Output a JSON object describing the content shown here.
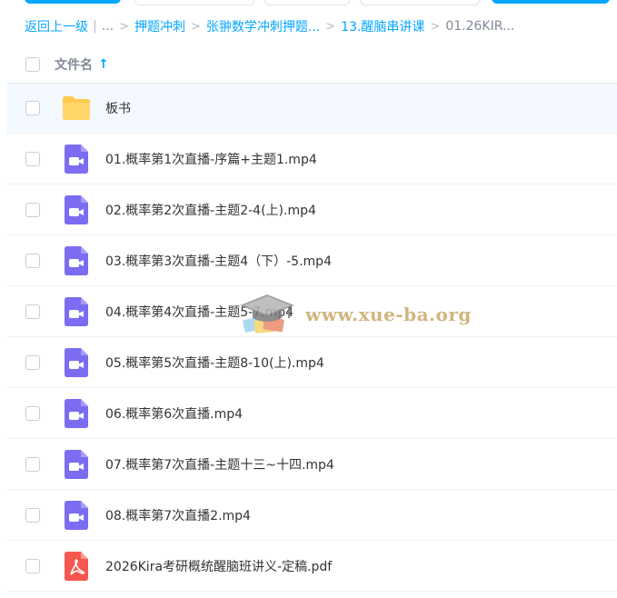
{
  "breadcrumb": {
    "back": "返回上一级",
    "ellipsis": "...",
    "items": [
      "押题冲刺",
      "张翀数学冲刺押题...",
      "13.醒脑串讲课"
    ],
    "current": "01.26KIR..."
  },
  "list_header": {
    "name_col": "文件名",
    "sort_icon": "arrow-up-icon"
  },
  "files": [
    {
      "name": "板书",
      "type": "folder"
    },
    {
      "name": "01.概率第1次直播-序篇+主题1.mp4",
      "type": "video"
    },
    {
      "name": "02.概率第2次直播-主题2-4(上).mp4",
      "type": "video"
    },
    {
      "name": "03.概率第3次直播-主题4（下）-5.mp4",
      "type": "video"
    },
    {
      "name": "04.概率第4次直播-主题5-7.mp4",
      "type": "video"
    },
    {
      "name": "05.概率第5次直播-主题8-10(上).mp4",
      "type": "video"
    },
    {
      "name": "06.概率第6次直播.mp4",
      "type": "video"
    },
    {
      "name": "07.概率第7次直播-主题十三~十四.mp4",
      "type": "video"
    },
    {
      "name": "08.概率第7次直播2.mp4",
      "type": "video"
    },
    {
      "name": "2026Kira考研概统醒脑班讲义-定稿.pdf",
      "type": "pdf"
    }
  ],
  "watermark": {
    "text": "www.xue-ba.org"
  },
  "colors": {
    "accent": "#06a7ff",
    "folder": "#ffc94d",
    "video": "#7b6cf2",
    "pdf": "#f5564f"
  }
}
